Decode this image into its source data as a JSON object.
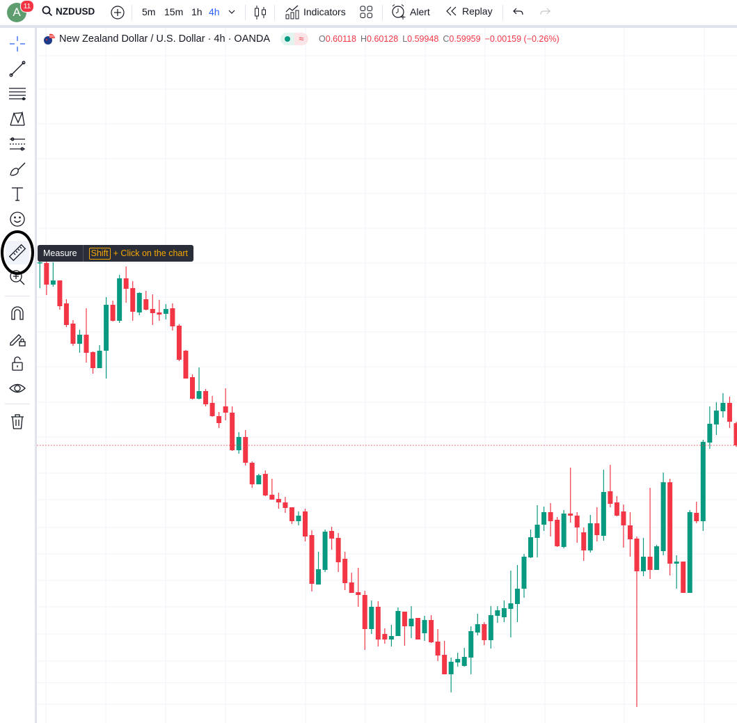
{
  "topbar": {
    "avatar_letter": "A",
    "notification_count": "11",
    "symbol": "NZDUSD",
    "intervals": [
      "5m",
      "15m",
      "1h",
      "4h"
    ],
    "active_interval": "4h",
    "indicators_label": "Indicators",
    "alert_label": "Alert",
    "replay_label": "Replay"
  },
  "sidebar": {
    "tools": [
      "crosshair-icon",
      "trend-line-icon",
      "fib-retracement-icon",
      "pattern-icon",
      "prediction-icon",
      "brush-icon",
      "text-icon",
      "emoji-icon",
      "ruler-icon",
      "zoom-in-icon",
      "magnet-icon",
      "lock-drawing-icon",
      "lock-icon",
      "eye-icon",
      "trash-icon"
    ],
    "active_tool": "ruler-icon"
  },
  "legend": {
    "title": "New Zealand Dollar / U.S. Dollar · 4h · OANDA",
    "status_symbol": "≈",
    "open_key": "O",
    "open": "0.60118",
    "high_key": "H",
    "high": "0.60128",
    "low_key": "L",
    "low": "0.59948",
    "close_key": "C",
    "close": "0.59959",
    "change": "−0.00159 (−0.26%)"
  },
  "tooltip": {
    "title": "Measure",
    "key": "Shift",
    "hint": "+ Click on the chart"
  },
  "colors": {
    "up": "#089981",
    "down": "#f23645",
    "accent": "#2962ff",
    "shortcut": "#f7a600",
    "annotation": "#000000"
  },
  "chart_data": {
    "type": "candlestick",
    "symbol": "NZDUSD",
    "interval": "4h",
    "last_price": 0.59959,
    "last_price_line": "dotted",
    "grid": true,
    "candles_ohlc": [
      [
        0.61269,
        0.61309,
        0.61089,
        0.61274
      ],
      [
        0.61269,
        0.61284,
        0.61039,
        0.61114
      ],
      [
        0.61114,
        0.61274,
        0.61099,
        0.61144
      ],
      [
        0.61144,
        0.61144,
        0.60934,
        0.60959
      ],
      [
        0.60979,
        0.61009,
        0.60809,
        0.60824
      ],
      [
        0.60834,
        0.60859,
        0.60674,
        0.60689
      ],
      [
        0.60689,
        0.60789,
        0.60624,
        0.60754
      ],
      [
        0.60754,
        0.60944,
        0.60554,
        0.60624
      ],
      [
        0.60629,
        0.60634,
        0.60474,
        0.60514
      ],
      [
        0.60514,
        0.60679,
        0.60514,
        0.60639
      ],
      [
        0.60639,
        0.61024,
        0.60439,
        0.60969
      ],
      [
        0.60969,
        0.60999,
        0.60849,
        0.60854
      ],
      [
        0.60854,
        0.61184,
        0.60839,
        0.61159
      ],
      [
        0.61159,
        0.61244,
        0.60984,
        0.61084
      ],
      [
        0.61089,
        0.61139,
        0.60854,
        0.60919
      ],
      [
        0.60914,
        0.61059,
        0.60894,
        0.61054
      ],
      [
        0.61009,
        0.61069,
        0.60929,
        0.60934
      ],
      [
        0.60939,
        0.61044,
        0.60824,
        0.60909
      ],
      [
        0.60914,
        0.61004,
        0.60854,
        0.60899
      ],
      [
        0.60904,
        0.60974,
        0.60864,
        0.60939
      ],
      [
        0.60944,
        0.60979,
        0.60784,
        0.60814
      ],
      [
        0.60819,
        0.60829,
        0.60564,
        0.60574
      ],
      [
        0.60639,
        0.60644,
        0.60439,
        0.60439
      ],
      [
        0.60449,
        0.60469,
        0.60289,
        0.60294
      ],
      [
        0.60294,
        0.60519,
        0.60289,
        0.60349
      ],
      [
        0.60349,
        0.60364,
        0.60239,
        0.60254
      ],
      [
        0.60264,
        0.60314,
        0.60164,
        0.60169
      ],
      [
        0.60169,
        0.60199,
        0.60084,
        0.60119
      ],
      [
        0.60239,
        0.60369,
        0.60139,
        0.60194
      ],
      [
        0.60194,
        0.60239,
        0.59919,
        0.59924
      ],
      [
        0.59924,
        0.60054,
        0.59899,
        0.60019
      ],
      [
        0.60019,
        0.60069,
        0.59814,
        0.59834
      ],
      [
        0.59834,
        0.59844,
        0.59654,
        0.59679
      ],
      [
        0.59679,
        0.59754,
        0.59679,
        0.59744
      ],
      [
        0.59754,
        0.59779,
        0.59594,
        0.59599
      ],
      [
        0.59604,
        0.59719,
        0.59569,
        0.59569
      ],
      [
        0.59574,
        0.59619,
        0.59504,
        0.59549
      ],
      [
        0.59549,
        0.59589,
        0.59474,
        0.59509
      ],
      [
        0.59514,
        0.59514,
        0.59394,
        0.59414
      ],
      [
        0.59414,
        0.59484,
        0.59384,
        0.59454
      ],
      [
        0.59484,
        0.59504,
        0.59269,
        0.59304
      ],
      [
        0.59314,
        0.59349,
        0.58909,
        0.58964
      ],
      [
        0.58959,
        0.59194,
        0.58959,
        0.59069
      ],
      [
        0.59064,
        0.59354,
        0.59049,
        0.59339
      ],
      [
        0.59344,
        0.59374,
        0.59209,
        0.59289
      ],
      [
        0.59294,
        0.59329,
        0.59049,
        0.59119
      ],
      [
        0.59144,
        0.59194,
        0.58919,
        0.58969
      ],
      [
        0.58974,
        0.59044,
        0.58899,
        0.58899
      ],
      [
        0.58904,
        0.59079,
        0.58799,
        0.58884
      ],
      [
        0.58884,
        0.58914,
        0.58489,
        0.58639
      ],
      [
        0.58639,
        0.58844,
        0.58604,
        0.58799
      ],
      [
        0.58799,
        0.58839,
        0.58514,
        0.58564
      ],
      [
        0.58604,
        0.58644,
        0.58534,
        0.58564
      ],
      [
        0.58564,
        0.58669,
        0.58514,
        0.58589
      ],
      [
        0.58589,
        0.58794,
        0.58589,
        0.58769
      ],
      [
        0.58764,
        0.58764,
        0.58519,
        0.58659
      ],
      [
        0.58659,
        0.58804,
        0.58574,
        0.58714
      ],
      [
        0.58719,
        0.58719,
        0.58564,
        0.58564
      ],
      [
        0.58609,
        0.58734,
        0.58554,
        0.58704
      ],
      [
        0.58704,
        0.58739,
        0.58539,
        0.58544
      ],
      [
        0.58549,
        0.58639,
        0.58409,
        0.58449
      ],
      [
        0.58454,
        0.58554,
        0.58314,
        0.58314
      ],
      [
        0.58314,
        0.58434,
        0.58184,
        0.58404
      ],
      [
        0.58399,
        0.58469,
        0.58369,
        0.58424
      ],
      [
        0.58374,
        0.58504,
        0.58369,
        0.58439
      ],
      [
        0.58434,
        0.58659,
        0.58314,
        0.58624
      ],
      [
        0.58614,
        0.58749,
        0.58594,
        0.58674
      ],
      [
        0.58674,
        0.58689,
        0.58524,
        0.58559
      ],
      [
        0.58559,
        0.58804,
        0.58499,
        0.58739
      ],
      [
        0.58734,
        0.58804,
        0.58684,
        0.58774
      ],
      [
        0.58724,
        0.58844,
        0.58689,
        0.58789
      ],
      [
        0.58784,
        0.59059,
        0.58579,
        0.58824
      ],
      [
        0.58819,
        0.59099,
        0.58689,
        0.58929
      ],
      [
        0.58929,
        0.59179,
        0.58864,
        0.59159
      ],
      [
        0.59154,
        0.59354,
        0.59149,
        0.59299
      ],
      [
        0.59294,
        0.59529,
        0.59154,
        0.59389
      ],
      [
        0.59389,
        0.59519,
        0.59344,
        0.59479
      ],
      [
        0.59479,
        0.59544,
        0.59304,
        0.59414
      ],
      [
        0.59424,
        0.59444,
        0.59229,
        0.59234
      ],
      [
        0.59229,
        0.59494,
        0.59219,
        0.59469
      ],
      [
        0.59469,
        0.59799,
        0.59404,
        0.59454
      ],
      [
        0.59454,
        0.59479,
        0.59259,
        0.59369
      ],
      [
        0.59334,
        0.59369,
        0.59129,
        0.59204
      ],
      [
        0.59204,
        0.59459,
        0.59189,
        0.59399
      ],
      [
        0.59399,
        0.59514,
        0.59269,
        0.59314
      ],
      [
        0.59309,
        0.59784,
        0.59274,
        0.59624
      ],
      [
        0.59629,
        0.59819,
        0.59514,
        0.59539
      ],
      [
        0.59549,
        0.59594,
        0.59449,
        0.59454
      ],
      [
        0.59484,
        0.59534,
        0.59224,
        0.59384
      ],
      [
        0.59384,
        0.59479,
        0.59159,
        0.59284
      ],
      [
        0.59289,
        0.59304,
        0.58079,
        0.59054
      ],
      [
        0.59054,
        0.59294,
        0.59019,
        0.59159
      ],
      [
        0.59159,
        0.59654,
        0.58999,
        0.59064
      ],
      [
        0.59064,
        0.59244,
        0.59064,
        0.59234
      ],
      [
        0.59199,
        0.59764,
        0.59169,
        0.59694
      ],
      [
        0.59694,
        0.59719,
        0.59024,
        0.59109
      ],
      [
        0.59109,
        0.59169,
        0.58929,
        0.59124
      ],
      [
        0.59124,
        0.59124,
        0.58899,
        0.58899
      ],
      [
        0.58899,
        0.59494,
        0.58899,
        0.59479
      ],
      [
        0.59474,
        0.59554,
        0.59399,
        0.59414
      ],
      [
        0.59414,
        0.59999,
        0.59344,
        0.59984
      ],
      [
        0.59979,
        0.60239,
        0.59934,
        0.60114
      ],
      [
        0.60109,
        0.60269,
        0.60034,
        0.60209
      ],
      [
        0.60204,
        0.60334,
        0.60159,
        0.60264
      ],
      [
        0.60264,
        0.60309,
        0.60084,
        0.60129
      ],
      [
        0.60118,
        0.60128,
        0.59948,
        0.59959
      ]
    ]
  }
}
